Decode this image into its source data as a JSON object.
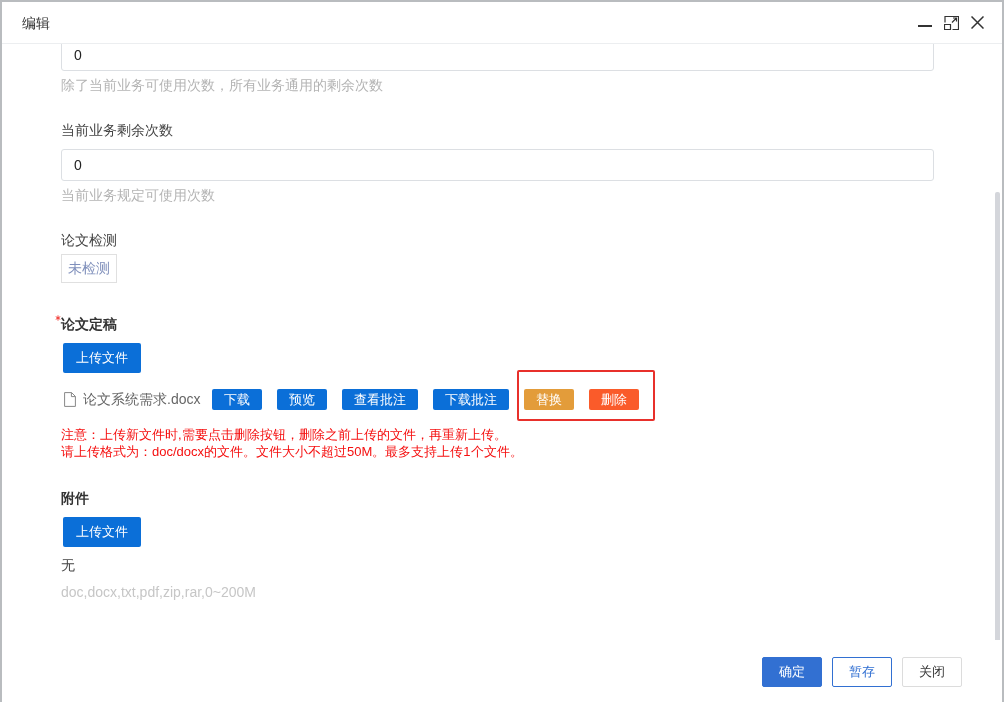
{
  "dialog": {
    "title": "编辑"
  },
  "form": {
    "fields": [
      {
        "kind": "input",
        "value": "0",
        "help": "除了当前业务可使用次数，所有业务通用的剩余次数"
      },
      {
        "kind": "input",
        "label": "当前业务剩余次数",
        "value": "0",
        "help": "当前业务规定可使用次数"
      },
      {
        "kind": "tag",
        "label": "论文检测",
        "tag": "未检测"
      },
      {
        "kind": "upload",
        "label": "论文定稿",
        "required": true,
        "upload_button": "上传文件",
        "files": [
          {
            "name": "论文系统需求.docx",
            "actions": [
              {
                "label": "下载",
                "kind": "primary"
              },
              {
                "label": "预览",
                "kind": "primary"
              },
              {
                "label": "查看批注",
                "kind": "primary"
              },
              {
                "label": "下载批注",
                "kind": "primary"
              }
            ],
            "highlighted_actions": [
              {
                "label": "替换",
                "kind": "warning"
              },
              {
                "label": "删除",
                "kind": "danger"
              }
            ]
          }
        ],
        "notes": [
          "注意：上传新文件时,需要点击删除按钮，删除之前上传的文件，再重新上传。",
          "请上传格式为：doc/docx的文件。文件大小不超过50M。最多支持上传1个文件。"
        ]
      },
      {
        "kind": "upload",
        "label": "附件",
        "required": false,
        "upload_button": "上传文件",
        "empty_text": "无",
        "hint": "doc,docx,txt,pdf,zip,rar,0~200M"
      }
    ]
  },
  "footer": {
    "buttons": [
      {
        "label": "确定",
        "kind": "primary"
      },
      {
        "label": "暂存",
        "kind": "outline"
      },
      {
        "label": "关闭",
        "kind": "default"
      }
    ]
  }
}
